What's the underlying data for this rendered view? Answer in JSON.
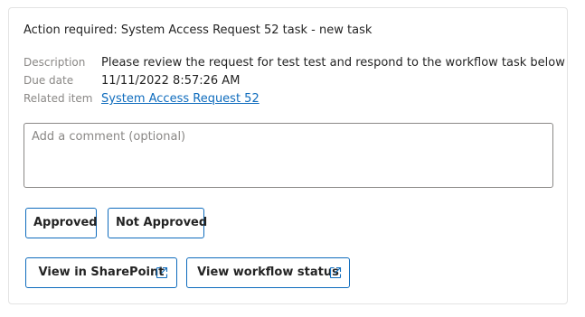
{
  "task": {
    "title": "Action required: System Access Request 52 task - new task"
  },
  "details": {
    "description_label": "Description",
    "description_value": "Please review the request for test test and respond to the workflow task below",
    "due_date_label": "Due date",
    "due_date_value": "11/11/2022 8:57:26 AM",
    "related_item_label": "Related item",
    "related_item_value": "System Access Request 52"
  },
  "comment": {
    "placeholder": "Add a comment (optional)",
    "value": ""
  },
  "actions": {
    "approved_label": "Approved",
    "not_approved_label": "Not Approved",
    "view_sharepoint_label": "View in SharePoint",
    "view_workflow_label": "View workflow status"
  },
  "icons": {
    "external_link": "external-link-icon"
  },
  "colors": {
    "accent": "#0f6cbd",
    "label_gray": "#8a8886",
    "text": "#242424",
    "card_border": "#e3e3e3"
  }
}
